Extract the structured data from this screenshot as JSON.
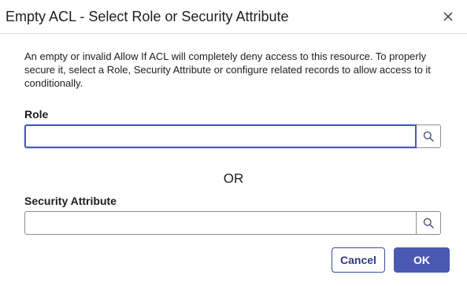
{
  "dialog": {
    "title": "Empty ACL - Select Role or Security Attribute",
    "close_icon": "close-icon",
    "description": "An empty or invalid Allow If ACL will completely deny access to this resource. To properly secure it, select a Role, Security Attribute or configure related records to allow access to it conditionally."
  },
  "role": {
    "label": "Role",
    "value": "",
    "search_icon": "search-icon"
  },
  "separator": {
    "text": "OR"
  },
  "security_attribute": {
    "label": "Security Attribute",
    "value": "",
    "search_icon": "search-icon"
  },
  "buttons": {
    "cancel_label": "Cancel",
    "ok_label": "OK"
  },
  "colors": {
    "primary": "#4b59b3",
    "focus_border": "#4b5bb9",
    "text": "#1e1e1e"
  }
}
